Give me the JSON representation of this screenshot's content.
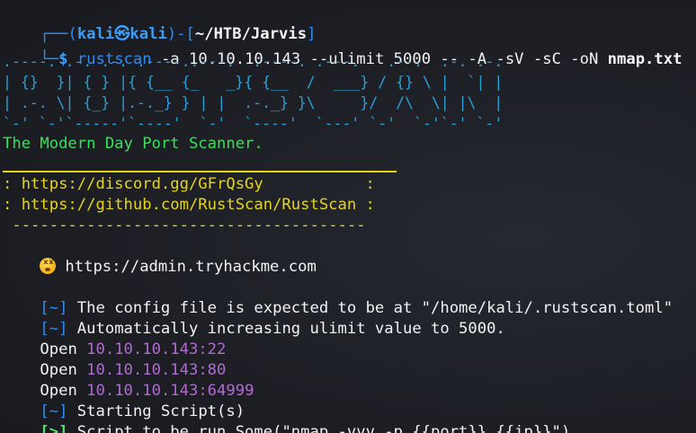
{
  "prompt": {
    "corner_top": "┌──(",
    "user": "kali",
    "at": "㉿",
    "host": "kali",
    "bracket_mid": ")-[",
    "path": "~/HTB/Jarvis",
    "bracket_end": "]",
    "corner_bottom": "└─",
    "dollar": "$ ",
    "command_name": "rustscan",
    "command_args": " -a 10.10.10.143 --ulimit 5000 -- -A -sV -sC -oN ",
    "command_output_file": "nmap.txt"
  },
  "banner": {
    "lines": [
      ".----. .-. .-. .----..---.  .----. .---.   .--.  .-. .-.",
      "| {}  }| { } |{ {__ {_   _}{ {__  /  ___} / {} \\ |  `| |",
      "| .-. \\| {_} |.-._} } | |  .-._} }\\     }/  /\\  \\| |\\  |",
      "`-' `-'`-----'`----'  `-'  `----'  `---' `-'  `-'`-' `-'"
    ],
    "tagline": "The Modern Day Port Scanner."
  },
  "links": {
    "discord": ": https://discord.gg/GFrQsGy           :",
    "github": ": https://github.com/RustScan/RustScan :",
    "dashes": " --------------------------------------",
    "tryhackme": "https://admin.tryhackme.com"
  },
  "output": {
    "config_bracket": "[~]",
    "config_text": " The config file is expected to be at \"/home/kali/.rustscan.toml\"",
    "ulimit_bracket": "[~]",
    "ulimit_text": " Automatically increasing ulimit value to 5000.",
    "open_label": "Open ",
    "ports": [
      "10.10.10.143:22",
      "10.10.10.143:80",
      "10.10.10.143:64999"
    ],
    "starting_bracket": "[~]",
    "starting_text": " Starting Script(s)",
    "script_bracket": "[>]",
    "script_text": " Script to be run Some(\"nmap -vvv -p {{port}} {{ip}}\")"
  },
  "colors": {
    "background": "#1c1e24",
    "prompt_blue": "#2f8cf2",
    "green": "#37e15a",
    "yellow": "#e5d51a",
    "purple": "#b06bd0"
  }
}
